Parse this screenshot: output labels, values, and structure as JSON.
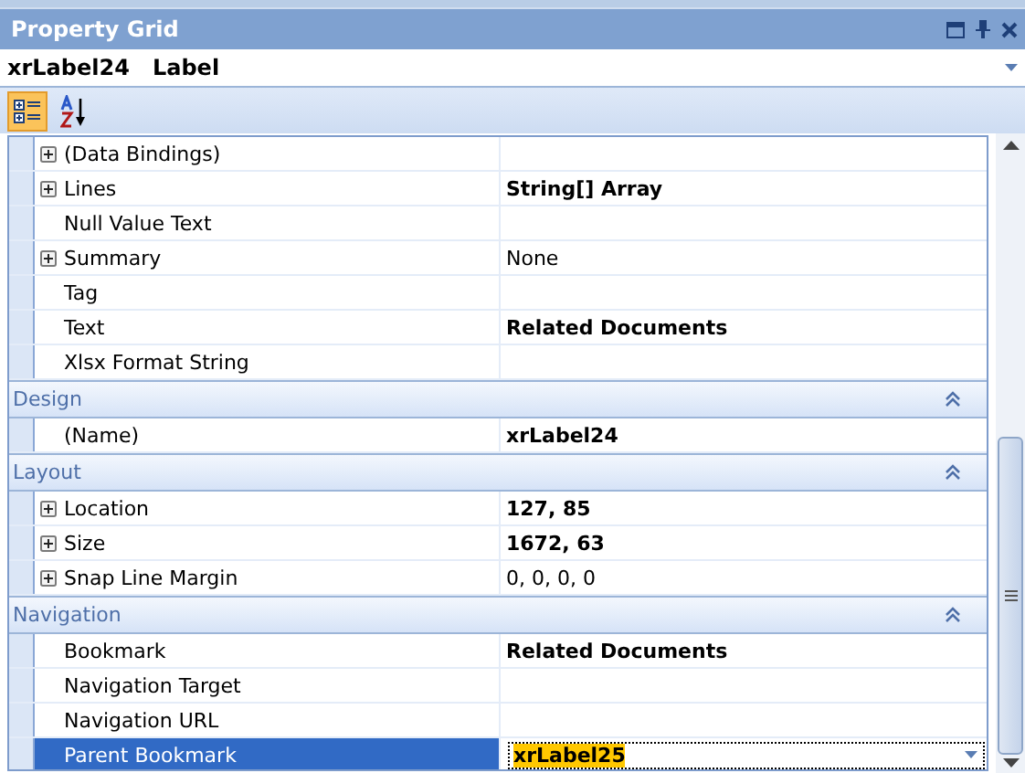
{
  "window": {
    "title": "Property Grid"
  },
  "object_selector": {
    "name": "xrLabel24",
    "type": "Label"
  },
  "toolbar": [
    {
      "kind": "categorized",
      "selected": true
    },
    {
      "kind": "alphabetical",
      "selected": false
    }
  ],
  "rows": [
    {
      "kind": "property",
      "name": "(Data Bindings)",
      "value": "",
      "expandable": true,
      "selected": false
    },
    {
      "kind": "property",
      "name": "Lines",
      "value": "String[] Array",
      "expandable": true,
      "modified": true,
      "selected": false
    },
    {
      "kind": "property",
      "name": "Null Value Text",
      "value": "",
      "expandable": false,
      "selected": false
    },
    {
      "kind": "property",
      "name": "Summary",
      "value": "None",
      "expandable": true,
      "modified": false,
      "selected": false
    },
    {
      "kind": "property",
      "name": "Tag",
      "value": "",
      "expandable": false,
      "selected": false
    },
    {
      "kind": "property",
      "name": "Text",
      "value": "Related Documents",
      "expandable": false,
      "modified": true,
      "selected": false
    },
    {
      "kind": "property",
      "name": "Xlsx Format String",
      "value": "",
      "expandable": false,
      "selected": false
    },
    {
      "kind": "category",
      "name": "Design",
      "expanded": true
    },
    {
      "kind": "property",
      "name": "(Name)",
      "value": "xrLabel24",
      "expandable": false,
      "modified": true,
      "selected": false
    },
    {
      "kind": "category",
      "name": "Layout",
      "expanded": true
    },
    {
      "kind": "property",
      "name": "Location",
      "value": "127, 85",
      "expandable": true,
      "modified": true,
      "selected": false
    },
    {
      "kind": "property",
      "name": "Size",
      "value": "1672, 63",
      "expandable": true,
      "modified": true,
      "selected": false
    },
    {
      "kind": "property",
      "name": "Snap Line Margin",
      "value": "0, 0, 0, 0",
      "expandable": true,
      "modified": false,
      "selected": false
    },
    {
      "kind": "category",
      "name": "Navigation",
      "expanded": true
    },
    {
      "kind": "property",
      "name": "Bookmark",
      "value": "Related Documents",
      "expandable": false,
      "modified": true,
      "selected": false
    },
    {
      "kind": "property",
      "name": "Navigation Target",
      "value": "",
      "expandable": false,
      "selected": false
    },
    {
      "kind": "property",
      "name": "Navigation URL",
      "value": "",
      "expandable": false,
      "selected": false
    },
    {
      "kind": "property",
      "name": "Parent Bookmark",
      "value": "xrLabel25",
      "expandable": false,
      "modified": true,
      "selected": true
    }
  ]
}
